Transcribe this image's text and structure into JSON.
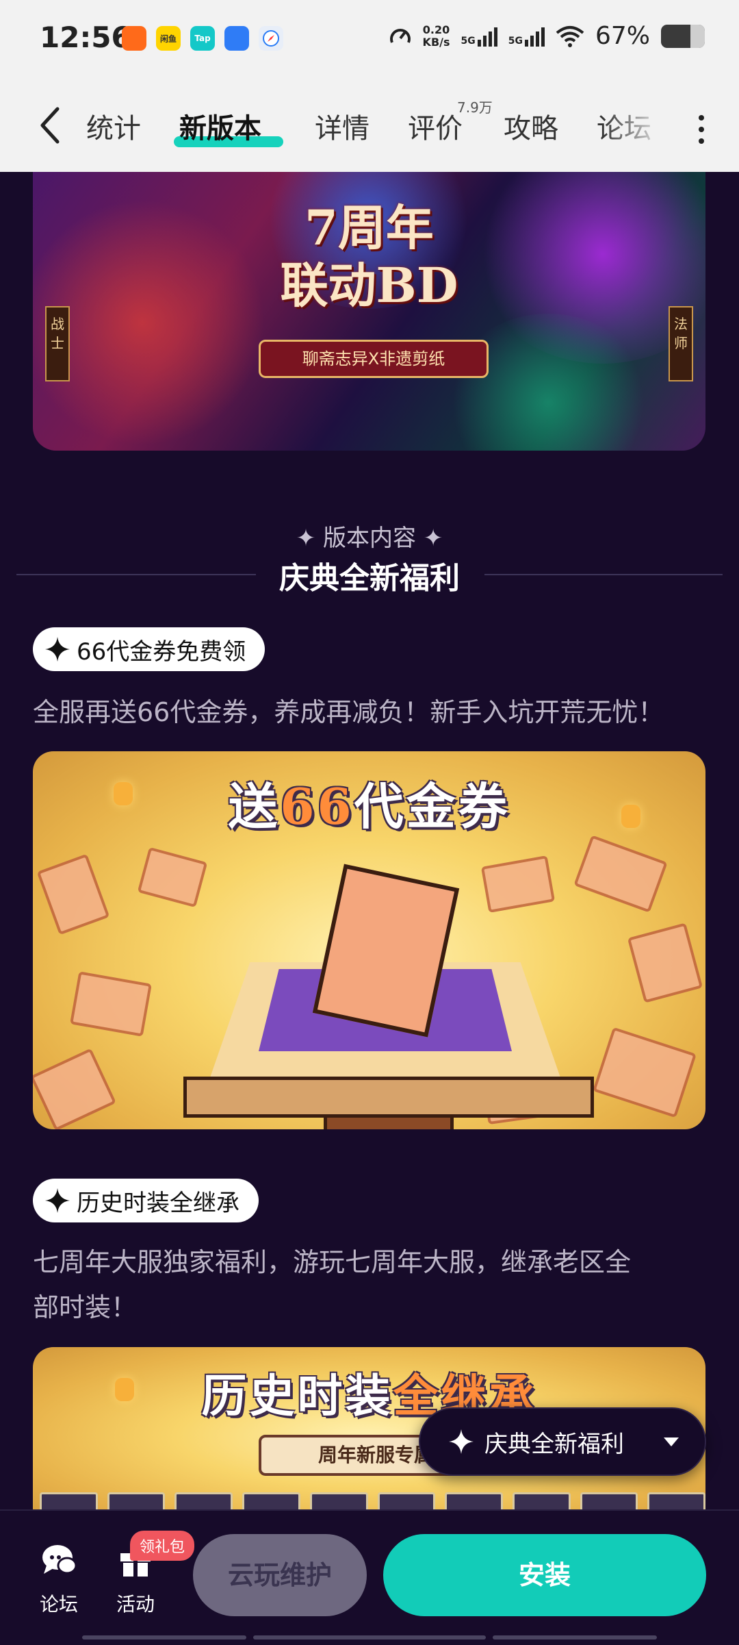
{
  "status_bar": {
    "time": "12:56",
    "net_speed_value": "0.20",
    "net_speed_unit": "KB/s",
    "sim1": "5G",
    "sim2": "5G",
    "battery": "67%",
    "app_icons": [
      "kuaishou-icon",
      "xianyu-icon",
      "taptap-icon",
      "browser-icon",
      "safari-icon"
    ],
    "app_icon_labels": [
      "",
      "闲鱼",
      "Tap",
      "",
      ""
    ]
  },
  "nav": {
    "tabs": [
      {
        "label": "统计"
      },
      {
        "label": "新版本"
      },
      {
        "label": "详情"
      },
      {
        "label": "评价"
      },
      {
        "label": "攻略"
      },
      {
        "label": "论坛"
      }
    ],
    "active_tab": "新版本",
    "rating_badge": "7.9万",
    "accent": "#16d2bc"
  },
  "banner": {
    "title_line1": "7周年",
    "title_line2": "联动BD",
    "subtitle": "聊斋志异X非遗剪纸",
    "tag_left": "战士",
    "tag_right": "法师"
  },
  "section": {
    "kicker": "版本内容",
    "title": "庆典全新福利"
  },
  "items": [
    {
      "pill": "66代金券免费领",
      "text": "全服再送66代金券，养成再减负！新手入坑开荒无忧！",
      "image_title_a": "送",
      "image_title_hl": "66",
      "image_title_b": "代金券"
    },
    {
      "pill": "历史时装全继承",
      "text_line1": "七周年大服独家福利，游玩七周年大服，继承老区全",
      "text_line2": "部时装！",
      "image_title_a": "历史时装",
      "image_title_hl": "全继承",
      "image_subtitle": "周年新服专属福利"
    }
  ],
  "floating_dropdown": {
    "label": "庆典全新福利"
  },
  "bottom_bar": {
    "forum_label": "论坛",
    "activity_label": "活动",
    "gift_badge": "领礼包",
    "cloud_button": "云玩维护",
    "install_button": "安装"
  }
}
